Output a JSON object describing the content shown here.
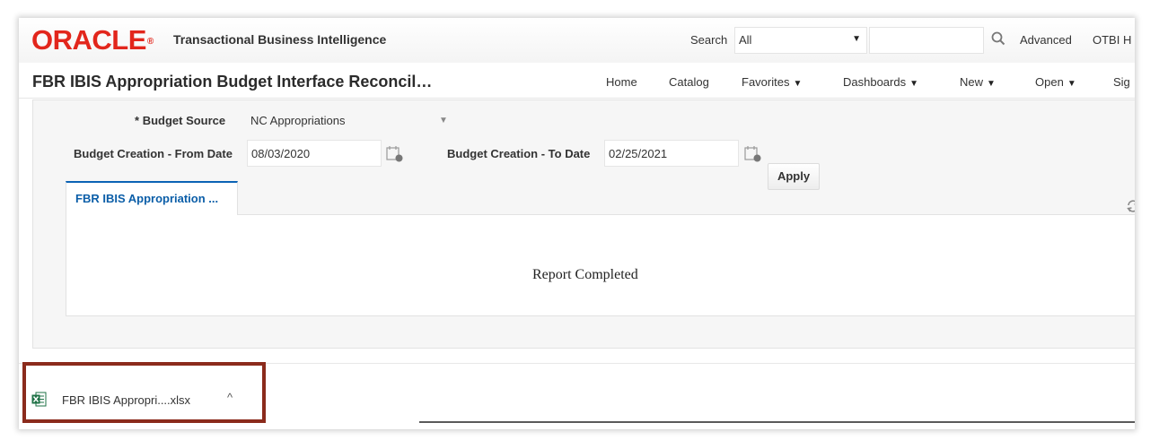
{
  "header": {
    "logo_text": "ORACLE",
    "logo_mark": "®",
    "product_name": "Transactional Business Intelligence",
    "search_label": "Search",
    "search_scope": "All",
    "search_value": "",
    "advanced_label": "Advanced",
    "otbi_label": "OTBI H"
  },
  "navbar": {
    "page_title": "FBR IBIS Appropriation Budget Interface Reconcil…",
    "items": [
      {
        "label": "Home",
        "caret": ""
      },
      {
        "label": "Catalog",
        "caret": ""
      },
      {
        "label": "Favorites",
        "caret": "▼"
      },
      {
        "label": "Dashboards",
        "caret": "▼"
      },
      {
        "label": "New",
        "caret": "▼"
      },
      {
        "label": "Open",
        "caret": "▼"
      },
      {
        "label": "Sig",
        "caret": ""
      }
    ]
  },
  "prompts": {
    "required_marker": "*",
    "budget_source_label": "Budget Source",
    "budget_source_value": "NC Appropriations",
    "from_date_label": "Budget Creation - From Date",
    "from_date_value": "08/03/2020",
    "to_date_label": "Budget Creation - To Date",
    "to_date_value": "02/25/2021",
    "apply_label": "Apply"
  },
  "report": {
    "tab_label": "FBR IBIS Appropriation ...",
    "status_text": "Report Completed"
  },
  "download": {
    "file_name": "FBR IBIS Appropri....xlsx",
    "chevron": "^"
  },
  "colors": {
    "oracle_red": "#e2261c",
    "tab_blue": "#0b63b5",
    "highlight_border": "#8b2b1c"
  }
}
